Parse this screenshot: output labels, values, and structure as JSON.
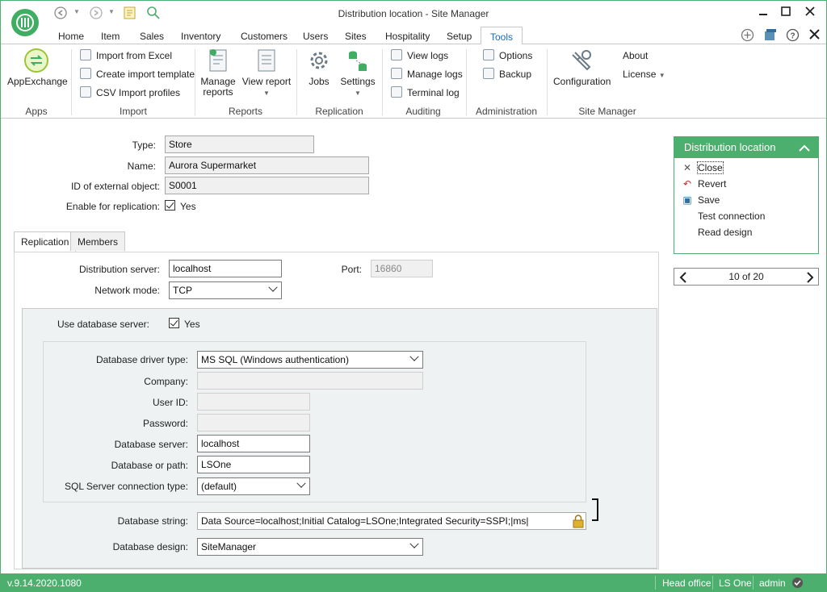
{
  "window": {
    "title": "Distribution location - Site Manager"
  },
  "menu_tabs": [
    "Home",
    "Item",
    "Sales",
    "Inventory",
    "Customers",
    "Users",
    "Sites",
    "Hospitality",
    "Setup",
    "Tools"
  ],
  "ribbon": {
    "apps": {
      "appexchange": "AppExchange",
      "group": "Apps"
    },
    "import": {
      "import_excel": "Import from Excel",
      "create_template": "Create import template",
      "csv_profiles": "CSV Import profiles",
      "group": "Import"
    },
    "reports": {
      "manage_reports": "Manage\nreports",
      "view_report": "View report",
      "group": "Reports"
    },
    "replication": {
      "jobs": "Jobs",
      "settings": "Settings",
      "group": "Replication"
    },
    "auditing": {
      "view_logs": "View logs",
      "manage_logs": "Manage logs",
      "terminal_log": "Terminal log",
      "group": "Auditing"
    },
    "administration": {
      "options": "Options",
      "backup": "Backup",
      "group": "Administration"
    },
    "site_manager": {
      "configuration": "Configuration",
      "about": "About",
      "license": "License",
      "group": "Site Manager"
    }
  },
  "form": {
    "type_label": "Type:",
    "type_value": "Store",
    "name_label": "Name:",
    "name_value": "Aurora Supermarket",
    "extid_label": "ID of external object:",
    "extid_value": "S0001",
    "replication_label": "Enable for replication:",
    "replication_value": "Yes"
  },
  "tabs": [
    "Replication",
    "Members"
  ],
  "replication": {
    "dist_server_label": "Distribution server:",
    "dist_server_value": "localhost",
    "port_label": "Port:",
    "port_value": "16860",
    "network_label": "Network mode:",
    "network_value": "TCP",
    "use_db_label": "Use database server:",
    "use_db_value": "Yes",
    "driver_label": "Database driver type:",
    "driver_value": "MS SQL (Windows authentication)",
    "company_label": "Company:",
    "userid_label": "User ID:",
    "password_label": "Password:",
    "db_server_label": "Database server:",
    "db_server_value": "localhost",
    "db_path_label": "Database or path:",
    "db_path_value": "LSOne",
    "conn_type_label": "SQL Server connection type:",
    "conn_type_value": "(default)",
    "db_string_label": "Database string:",
    "db_string_value": "Data Source=localhost;Initial Catalog=LSOne;Integrated Security=SSPI;|ms|",
    "db_design_label": "Database design:",
    "db_design_value": "SiteManager"
  },
  "side_panel": {
    "title": "Distribution location",
    "items": [
      "Close",
      "Revert",
      "Save",
      "Test connection",
      "Read design"
    ]
  },
  "pager": {
    "text": "10 of 20"
  },
  "status": {
    "version": "v.9.14.2020.1080",
    "location": "Head office",
    "product": "LS One",
    "user": "admin"
  },
  "colors": {
    "accent": "#4caf6e",
    "tab_active": "#1a6bb8"
  }
}
